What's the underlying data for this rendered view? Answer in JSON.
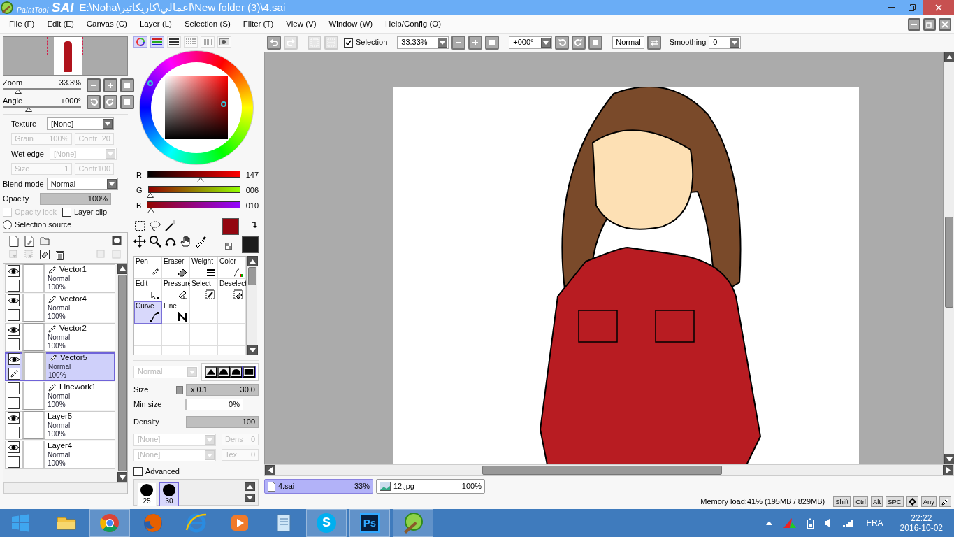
{
  "window": {
    "logo_small": "PaintTool",
    "logo": "SAI",
    "title": "E:\\Noha\\اعمالي\\كاريكاتير\\New folder (3)\\4.sai"
  },
  "menu": [
    "File (F)",
    "Edit (E)",
    "Canvas (C)",
    "Layer (L)",
    "Selection (S)",
    "Filter (T)",
    "View (V)",
    "Window (W)",
    "Help/Config (O)"
  ],
  "navigator": {
    "zoom": {
      "label": "Zoom",
      "value": "33.3%",
      "level": 0.2
    },
    "angle": {
      "label": "Angle",
      "value": "+000°",
      "level": 0.33
    }
  },
  "texture": {
    "label": "Texture",
    "value": "[None]",
    "disabled": false
  },
  "texture_params": [
    {
      "label": "Grain",
      "value": "100%",
      "disabled": true
    },
    {
      "label": "Contr",
      "value": "20",
      "disabled": true
    }
  ],
  "wet_edge": {
    "label": "Wet edge",
    "value": "[None]",
    "disabled": true
  },
  "wet_edge_params": [
    {
      "label": "Size",
      "value": "1",
      "disabled": true
    },
    {
      "label": "Contr",
      "value": "100",
      "disabled": true
    }
  ],
  "blend_mode": {
    "label": "Blend mode",
    "value": "Normal"
  },
  "opacity": {
    "label": "Opacity",
    "value": "100%",
    "level": 1
  },
  "layer_options": [
    {
      "label": "Opacity lock",
      "checked": false,
      "disabled": true
    },
    {
      "label": "Layer clip",
      "checked": false,
      "disabled": false
    }
  ],
  "selection_source": {
    "label": "Selection source",
    "selected": false
  },
  "layers": [
    {
      "name": "Vector1",
      "kind": "vector",
      "blend": "Normal",
      "opacity": "100%",
      "visible": true,
      "selected": false
    },
    {
      "name": "Vector4",
      "kind": "vector",
      "blend": "Normal",
      "opacity": "100%",
      "visible": true,
      "selected": false
    },
    {
      "name": "Vector2",
      "kind": "vector",
      "blend": "Normal",
      "opacity": "100%",
      "visible": true,
      "selected": false
    },
    {
      "name": "Vector5",
      "kind": "vector",
      "blend": "Normal",
      "opacity": "100%",
      "visible": true,
      "selected": true
    },
    {
      "name": "Linework1",
      "kind": "vector",
      "blend": "Normal",
      "opacity": "100%",
      "visible": false,
      "selected": false
    },
    {
      "name": "Layer5",
      "kind": "raster",
      "blend": "Normal",
      "opacity": "100%",
      "visible": true,
      "selected": false
    },
    {
      "name": "Layer4",
      "kind": "raster",
      "blend": "Normal",
      "opacity": "100%",
      "visible": true,
      "selected": false
    }
  ],
  "color_tabs": [
    {
      "kind": "wheel",
      "selected": true
    },
    {
      "kind": "rgb",
      "selected": true
    },
    {
      "kind": "hsv",
      "selected": false
    },
    {
      "kind": "swatches",
      "selected": false
    },
    {
      "kind": "grid",
      "selected": false
    },
    {
      "kind": "scratchpad",
      "selected": false
    }
  ],
  "rgb": [
    {
      "label": "R",
      "value": "147",
      "level": 0.576
    },
    {
      "label": "G",
      "value": "006",
      "level": 0.024
    },
    {
      "label": "B",
      "value": "010",
      "level": 0.039
    }
  ],
  "swatches": [
    {
      "color": "#930610"
    },
    {
      "color": "#1b1b1b"
    }
  ],
  "brush_tools": [
    {
      "label": "Pen",
      "kind": "pen",
      "selected": false
    },
    {
      "label": "Eraser",
      "kind": "eraser",
      "selected": false
    },
    {
      "label": "Weight",
      "kind": "weight",
      "selected": false
    },
    {
      "label": "Color",
      "kind": "color",
      "selected": false
    },
    {
      "label": "Edit",
      "kind": "edit",
      "selected": false
    },
    {
      "label": "Pressure",
      "kind": "pressure",
      "selected": false
    },
    {
      "label": "Select",
      "kind": "select",
      "selected": false
    },
    {
      "label": "Deselect",
      "kind": "deselect",
      "selected": false
    },
    {
      "label": "Curve",
      "kind": "curve",
      "selected": true
    },
    {
      "label": "Line",
      "kind": "line",
      "selected": false
    }
  ],
  "brush_mode": {
    "value": "Normal",
    "disabled": true
  },
  "brush_shapes": [
    {
      "selected": false
    },
    {
      "selected": false
    },
    {
      "selected": false
    },
    {
      "selected": true
    }
  ],
  "brush_size": {
    "label": "Size",
    "multiplier": "x 0.1",
    "value": "30.0",
    "level": 1
  },
  "min_size": {
    "label": "Min size",
    "value": "0%",
    "level": 0
  },
  "density": {
    "label": "Density",
    "value": "100",
    "level": 1
  },
  "brush_textures": [
    {
      "value": "[None]",
      "param_label": "Dens",
      "param_value": "0",
      "disabled": true
    },
    {
      "value": "[None]",
      "param_label": "Tex.",
      "param_value": "0",
      "disabled": true
    }
  ],
  "advanced": {
    "label": "Advanced",
    "checked": false
  },
  "brush_presets": [
    {
      "size": "25",
      "selected": false
    },
    {
      "size": "30",
      "selected": true
    }
  ],
  "canvas_toolbar": {
    "selection": {
      "label": "Selection",
      "checked": true
    },
    "zoom": "33.33%",
    "angle": "+000°",
    "blend": "Normal",
    "smoothing_label": "Smoothing",
    "smoothing": "0"
  },
  "documents": [
    {
      "name": "4.sai",
      "zoom": "33%",
      "kind": "sai",
      "selected": true
    },
    {
      "name": "12.jpg",
      "zoom": "100%",
      "kind": "image",
      "selected": false
    }
  ],
  "status_bar": {
    "memory": "Memory load:41% (195MB / 829MB)",
    "keys": [
      {
        "kind": "text",
        "label": "Shift"
      },
      {
        "kind": "text",
        "label": "Ctrl"
      },
      {
        "kind": "text",
        "label": "Alt"
      },
      {
        "kind": "text",
        "label": "SPC"
      },
      {
        "kind": "move"
      },
      {
        "kind": "text",
        "label": "Any"
      },
      {
        "kind": "pen"
      }
    ]
  },
  "taskbar": {
    "apps": [
      {
        "kind": "explorer",
        "running": false
      },
      {
        "kind": "chrome",
        "running": true
      },
      {
        "kind": "firefox",
        "running": false
      },
      {
        "kind": "ie",
        "running": false
      },
      {
        "kind": "media",
        "running": false
      },
      {
        "kind": "notepad",
        "running": false
      },
      {
        "kind": "skype",
        "label": "S",
        "running": true
      },
      {
        "kind": "photoshop",
        "label": "Ps",
        "running": true
      },
      {
        "kind": "sai",
        "running": true
      }
    ],
    "tray": {
      "language": "FRA",
      "time": "22:22",
      "date": "2016-10-02"
    }
  }
}
